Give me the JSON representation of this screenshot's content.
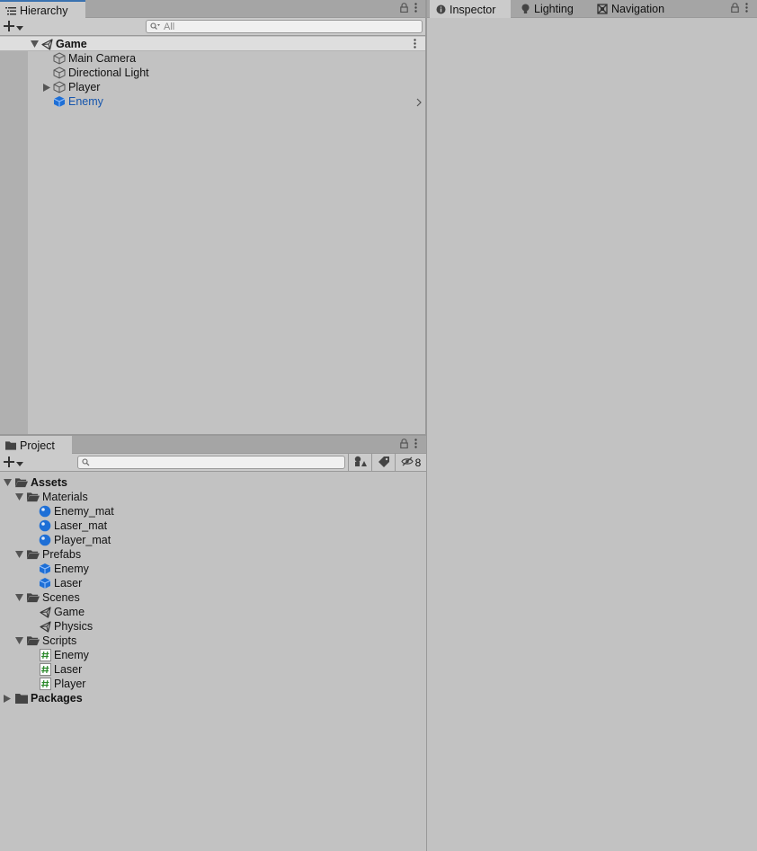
{
  "hierarchy": {
    "tab_label": "Hierarchy",
    "search_placeholder": "All",
    "scene": {
      "name": "Game"
    },
    "items": [
      {
        "label": "Main Camera"
      },
      {
        "label": "Directional Light"
      },
      {
        "label": "Player"
      },
      {
        "label": "Enemy"
      }
    ]
  },
  "inspector": {
    "tabs": [
      {
        "label": "Inspector"
      },
      {
        "label": "Lighting"
      },
      {
        "label": "Navigation"
      }
    ]
  },
  "project": {
    "tab_label": "Project",
    "search_placeholder": "",
    "hidden_count": "8",
    "tree": [
      {
        "label": "Assets"
      },
      {
        "label": "Materials"
      },
      {
        "label": "Enemy_mat"
      },
      {
        "label": "Laser_mat"
      },
      {
        "label": "Player_mat"
      },
      {
        "label": "Prefabs"
      },
      {
        "label": "Enemy"
      },
      {
        "label": "Laser"
      },
      {
        "label": "Scenes"
      },
      {
        "label": "Game"
      },
      {
        "label": "Physics"
      },
      {
        "label": "Scripts"
      },
      {
        "label": "Enemy"
      },
      {
        "label": "Laser"
      },
      {
        "label": "Player"
      },
      {
        "label": "Packages"
      }
    ]
  },
  "colors": {
    "selected_text": "#1756ad",
    "prefab_blue": "#1e6fd6",
    "tab_accent": "#3a72b0",
    "script_green": "#2c8a2c"
  }
}
